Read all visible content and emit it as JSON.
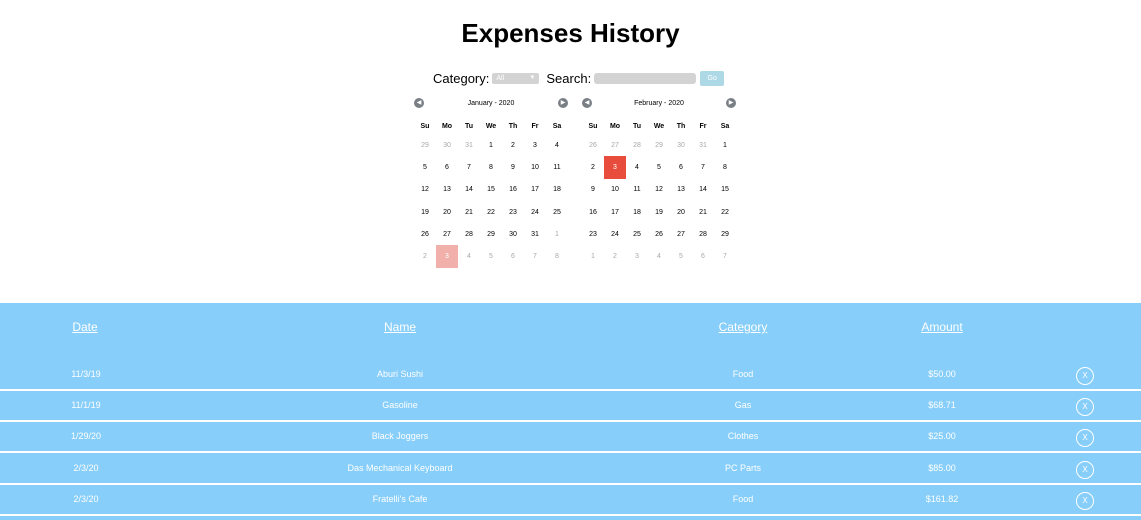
{
  "page": {
    "title": "Expenses History"
  },
  "filters": {
    "category_label": "Category:",
    "category_value": "All",
    "search_label": "Search:",
    "search_value": "",
    "go_label": "Go"
  },
  "calendars": [
    {
      "month_label": "January - 2020",
      "weekdays": [
        "Su",
        "Mo",
        "Tu",
        "We",
        "Th",
        "Fr",
        "Sa"
      ],
      "weeks": [
        [
          {
            "d": "29",
            "o": true
          },
          {
            "d": "30",
            "o": true
          },
          {
            "d": "31",
            "o": true
          },
          {
            "d": "1"
          },
          {
            "d": "2"
          },
          {
            "d": "3"
          },
          {
            "d": "4"
          }
        ],
        [
          {
            "d": "5"
          },
          {
            "d": "6"
          },
          {
            "d": "7"
          },
          {
            "d": "8"
          },
          {
            "d": "9"
          },
          {
            "d": "10"
          },
          {
            "d": "11"
          }
        ],
        [
          {
            "d": "12"
          },
          {
            "d": "13"
          },
          {
            "d": "14"
          },
          {
            "d": "15"
          },
          {
            "d": "16"
          },
          {
            "d": "17"
          },
          {
            "d": "18"
          }
        ],
        [
          {
            "d": "19"
          },
          {
            "d": "20"
          },
          {
            "d": "21"
          },
          {
            "d": "22"
          },
          {
            "d": "23"
          },
          {
            "d": "24"
          },
          {
            "d": "25"
          }
        ],
        [
          {
            "d": "26"
          },
          {
            "d": "27"
          },
          {
            "d": "28"
          },
          {
            "d": "29"
          },
          {
            "d": "30"
          },
          {
            "d": "31"
          },
          {
            "d": "1",
            "o": true
          }
        ],
        [
          {
            "d": "2",
            "o": true
          },
          {
            "d": "3",
            "o": true,
            "t": true
          },
          {
            "d": "4",
            "o": true
          },
          {
            "d": "5",
            "o": true
          },
          {
            "d": "6",
            "o": true
          },
          {
            "d": "7",
            "o": true
          },
          {
            "d": "8",
            "o": true
          }
        ]
      ]
    },
    {
      "month_label": "February - 2020",
      "weekdays": [
        "Su",
        "Mo",
        "Tu",
        "We",
        "Th",
        "Fr",
        "Sa"
      ],
      "weeks": [
        [
          {
            "d": "26",
            "o": true
          },
          {
            "d": "27",
            "o": true
          },
          {
            "d": "28",
            "o": true
          },
          {
            "d": "29",
            "o": true
          },
          {
            "d": "30",
            "o": true
          },
          {
            "d": "31",
            "o": true
          },
          {
            "d": "1"
          }
        ],
        [
          {
            "d": "2"
          },
          {
            "d": "3",
            "s": true
          },
          {
            "d": "4"
          },
          {
            "d": "5"
          },
          {
            "d": "6"
          },
          {
            "d": "7"
          },
          {
            "d": "8"
          }
        ],
        [
          {
            "d": "9"
          },
          {
            "d": "10"
          },
          {
            "d": "11"
          },
          {
            "d": "12"
          },
          {
            "d": "13"
          },
          {
            "d": "14"
          },
          {
            "d": "15"
          }
        ],
        [
          {
            "d": "16"
          },
          {
            "d": "17"
          },
          {
            "d": "18"
          },
          {
            "d": "19"
          },
          {
            "d": "20"
          },
          {
            "d": "21"
          },
          {
            "d": "22"
          }
        ],
        [
          {
            "d": "23"
          },
          {
            "d": "24"
          },
          {
            "d": "25"
          },
          {
            "d": "26"
          },
          {
            "d": "27"
          },
          {
            "d": "28"
          },
          {
            "d": "29"
          }
        ],
        [
          {
            "d": "1",
            "o": true
          },
          {
            "d": "2",
            "o": true
          },
          {
            "d": "3",
            "o": true
          },
          {
            "d": "4",
            "o": true
          },
          {
            "d": "5",
            "o": true
          },
          {
            "d": "6",
            "o": true
          },
          {
            "d": "7",
            "o": true
          }
        ]
      ]
    }
  ],
  "table": {
    "headers": {
      "date": "Date",
      "name": "Name",
      "category": "Category",
      "amount": "Amount"
    },
    "delete_label": "X",
    "rows": [
      {
        "date": "11/3/19",
        "name": "Aburi Sushi",
        "category": "Food",
        "amount": "$50.00"
      },
      {
        "date": "11/1/19",
        "name": "Gasoline",
        "category": "Gas",
        "amount": "$68.71"
      },
      {
        "date": "1/29/20",
        "name": "Black Joggers",
        "category": "Clothes",
        "amount": "$25.00"
      },
      {
        "date": "2/3/20",
        "name": "Das Mechanical Keyboard",
        "category": "PC Parts",
        "amount": "$85.00"
      },
      {
        "date": "2/3/20",
        "name": "Fratelli's Cafe",
        "category": "Food",
        "amount": "$161.82"
      }
    ]
  },
  "colors": {
    "table_bg": "#87cefa",
    "selected_day": "#e74c3c",
    "today_day": "#f2b0aa",
    "go_button": "#add8e6"
  },
  "icons": {
    "prev_month": "left-arrow-icon",
    "next_month": "right-arrow-icon",
    "delete": "close-icon"
  }
}
